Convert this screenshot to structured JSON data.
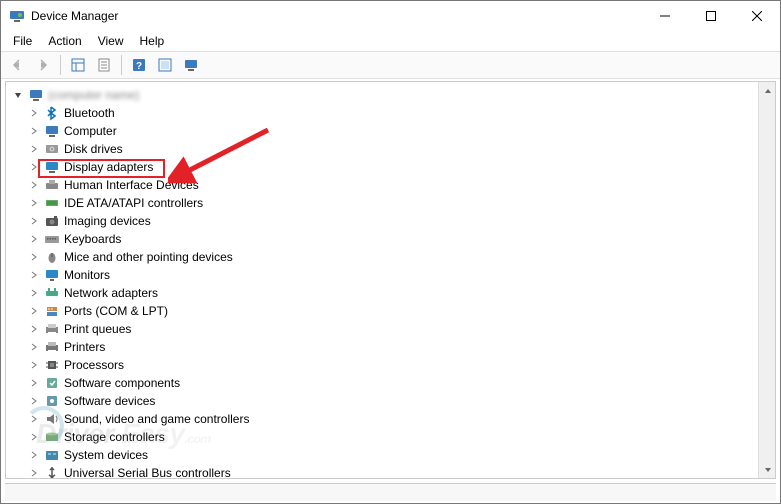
{
  "window": {
    "title": "Device Manager"
  },
  "menubar": {
    "items": [
      "File",
      "Action",
      "View",
      "Help"
    ]
  },
  "toolbar": {
    "buttons": [
      {
        "name": "back-icon",
        "enabled": false
      },
      {
        "name": "forward-icon",
        "enabled": false
      },
      {
        "name": "show-hidden-icon",
        "enabled": true
      },
      {
        "name": "properties-icon",
        "enabled": true
      },
      {
        "name": "help-icon",
        "enabled": true
      },
      {
        "name": "legacy-icon",
        "enabled": true
      },
      {
        "name": "monitor-icon",
        "enabled": true
      }
    ]
  },
  "tree": {
    "root": {
      "label": "(computer name)",
      "expanded": true
    },
    "items": [
      {
        "icon": "bluetooth",
        "label": "Bluetooth"
      },
      {
        "icon": "computer",
        "label": "Computer"
      },
      {
        "icon": "disk",
        "label": "Disk drives"
      },
      {
        "icon": "display",
        "label": "Display adapters",
        "highlighted": true
      },
      {
        "icon": "hid",
        "label": "Human Interface Devices"
      },
      {
        "icon": "ide",
        "label": "IDE ATA/ATAPI controllers"
      },
      {
        "icon": "imaging",
        "label": "Imaging devices"
      },
      {
        "icon": "keyboard",
        "label": "Keyboards"
      },
      {
        "icon": "mouse",
        "label": "Mice and other pointing devices"
      },
      {
        "icon": "monitor",
        "label": "Monitors"
      },
      {
        "icon": "network",
        "label": "Network adapters"
      },
      {
        "icon": "ports",
        "label": "Ports (COM & LPT)"
      },
      {
        "icon": "printqueue",
        "label": "Print queues"
      },
      {
        "icon": "printer",
        "label": "Printers"
      },
      {
        "icon": "processor",
        "label": "Processors"
      },
      {
        "icon": "software",
        "label": "Software components"
      },
      {
        "icon": "softdev",
        "label": "Software devices"
      },
      {
        "icon": "sound",
        "label": "Sound, video and game controllers"
      },
      {
        "icon": "storage",
        "label": "Storage controllers"
      },
      {
        "icon": "system",
        "label": "System devices"
      },
      {
        "icon": "usb",
        "label": "Universal Serial Bus controllers"
      }
    ]
  },
  "annotation": {
    "highlight_target": "Display adapters",
    "arrow_color": "#e32228"
  },
  "watermark": "Driver Easy"
}
